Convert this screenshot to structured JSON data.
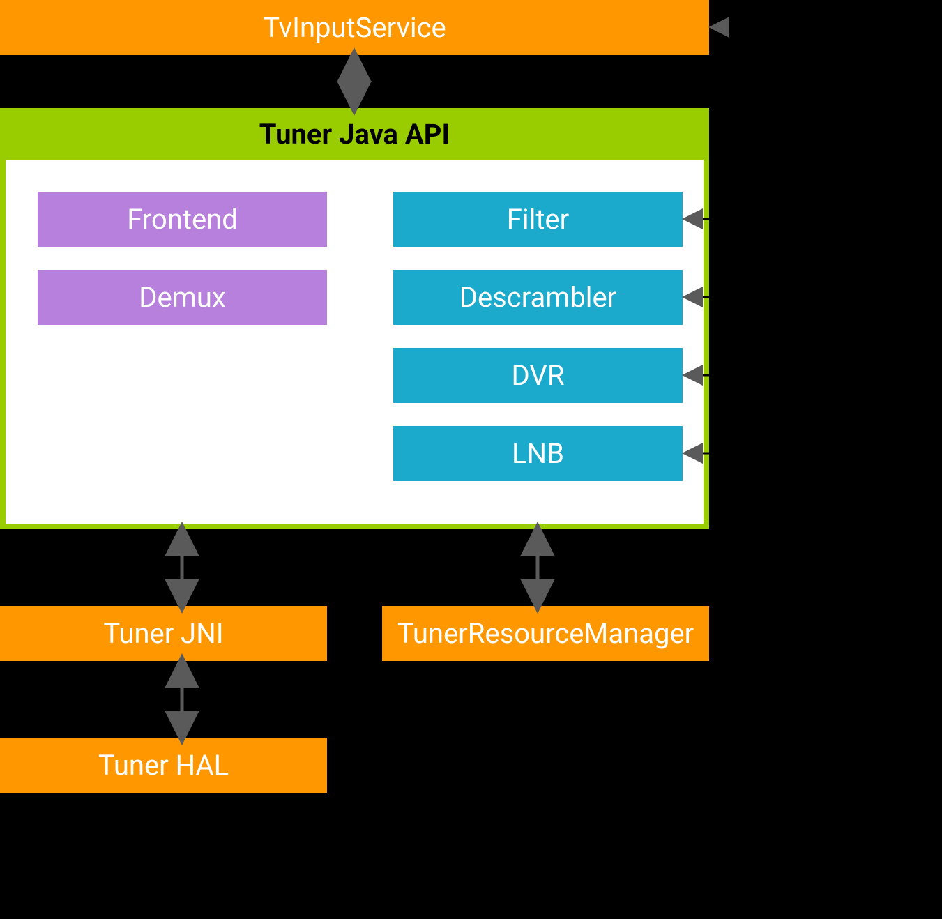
{
  "top_box": {
    "label": "TvInputService"
  },
  "api_container": {
    "title": "Tuner Java API",
    "left_column": [
      {
        "label": "Frontend"
      },
      {
        "label": "Demux"
      }
    ],
    "right_column": [
      {
        "label": "Filter"
      },
      {
        "label": "Descrambler"
      },
      {
        "label": "DVR"
      },
      {
        "label": "LNB"
      }
    ]
  },
  "bottom_left": {
    "jni_label": "Tuner JNI",
    "hal_label": "Tuner HAL"
  },
  "bottom_right": {
    "trm_label": "TunerResourceManager"
  },
  "colors": {
    "orange": "#ff9800",
    "green": "#9acd00",
    "purple": "#b880dd",
    "blue": "#1ba9cc",
    "black": "#000000",
    "white": "#ffffff",
    "arrow": "#5a5a5a"
  }
}
